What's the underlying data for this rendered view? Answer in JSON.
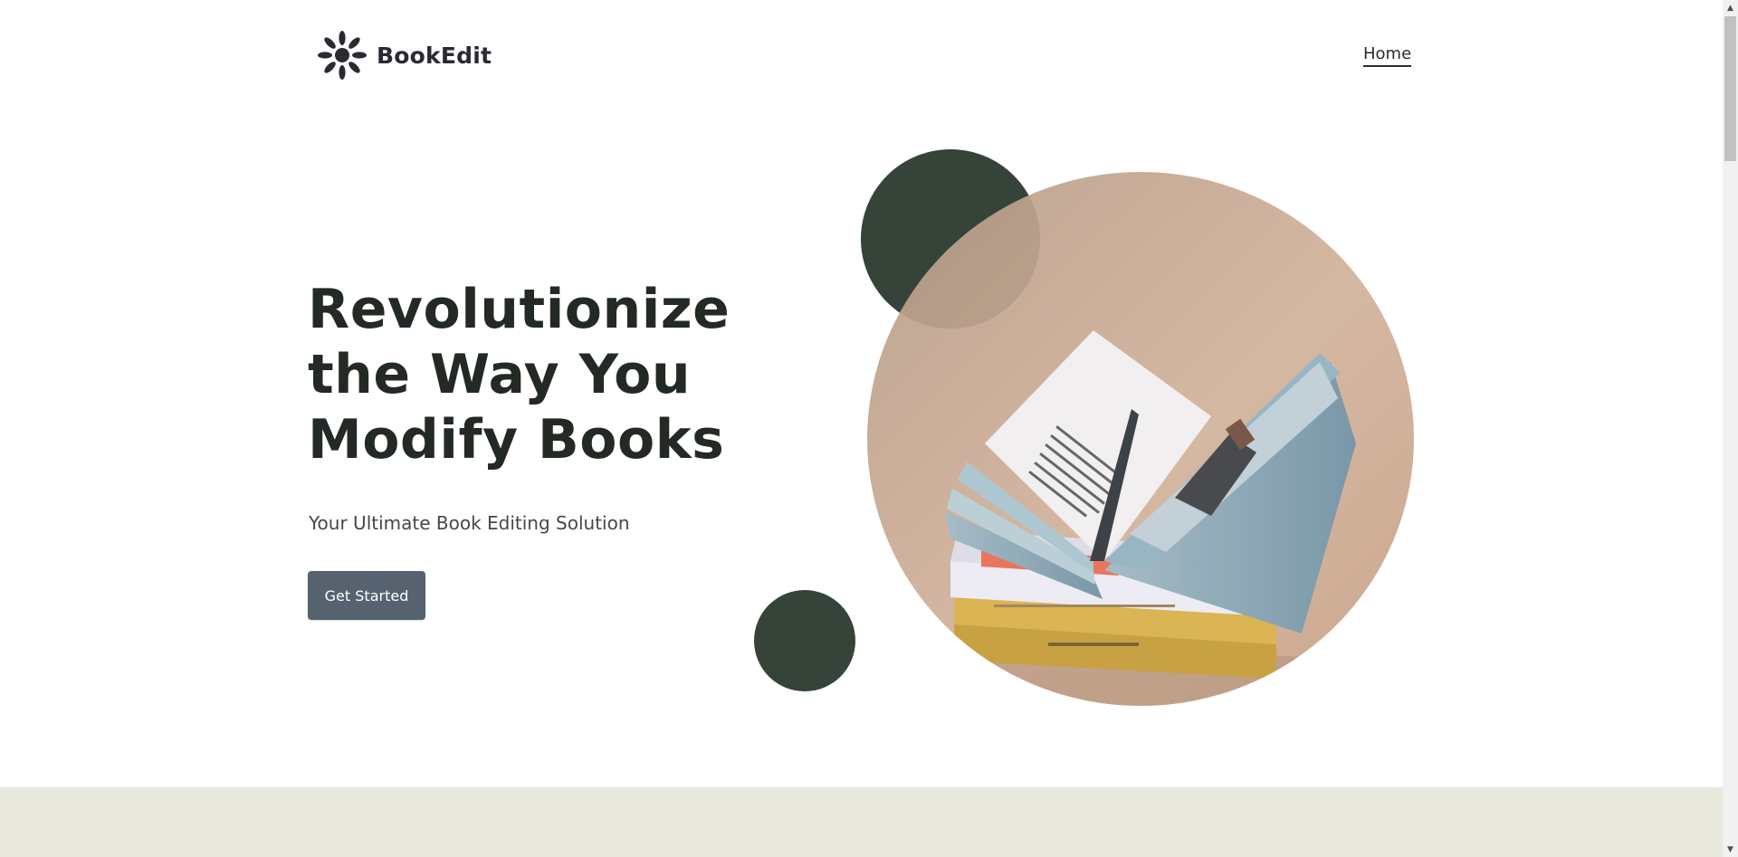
{
  "header": {
    "brand": "BookEdit",
    "logo_icon": "sunburst-logo-icon",
    "nav": [
      {
        "label": "Home",
        "active": true
      }
    ]
  },
  "hero": {
    "title": "Revolutionize the Way You Modify Books",
    "subtitle": "Your Ultimate Book Editing Solution",
    "cta_label": "Get Started",
    "image_icon": "open-book-photo"
  },
  "colors": {
    "text_dark": "#232a24",
    "accent_dark_green": "#354339",
    "button_slate": "#566270",
    "band_beige": "#e9e9de",
    "photo_background": "#c7a58d"
  },
  "scrollbar": {
    "up_icon": "scroll-up-arrow-icon",
    "down_icon": "scroll-down-arrow-icon"
  }
}
